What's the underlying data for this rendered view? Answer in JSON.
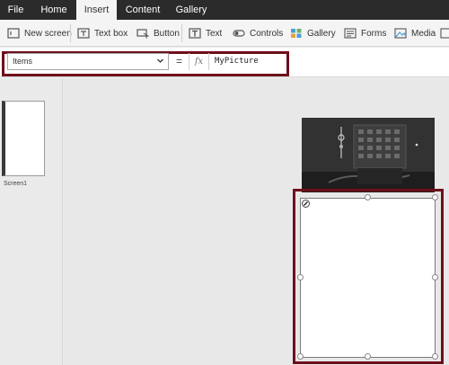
{
  "tabs": [
    {
      "label": "File",
      "active": false
    },
    {
      "label": "Home",
      "active": false
    },
    {
      "label": "Insert",
      "active": true
    },
    {
      "label": "Content",
      "active": false
    },
    {
      "label": "Gallery",
      "active": false
    }
  ],
  "ribbon": {
    "new_screen": "New screen",
    "text_box": "Text box",
    "button": "Button",
    "text": "Text",
    "controls": "Controls",
    "gallery": "Gallery",
    "forms": "Forms",
    "media": "Media"
  },
  "formula_bar": {
    "property": "Items",
    "equals": "=",
    "fx": "fx",
    "formula": "MyPicture"
  },
  "screens": [
    {
      "label": "Screen1"
    }
  ],
  "colors": {
    "highlight": "#6e0f1b",
    "tabbar": "#2b2b2b",
    "active_tab": "#f4f4f4"
  }
}
